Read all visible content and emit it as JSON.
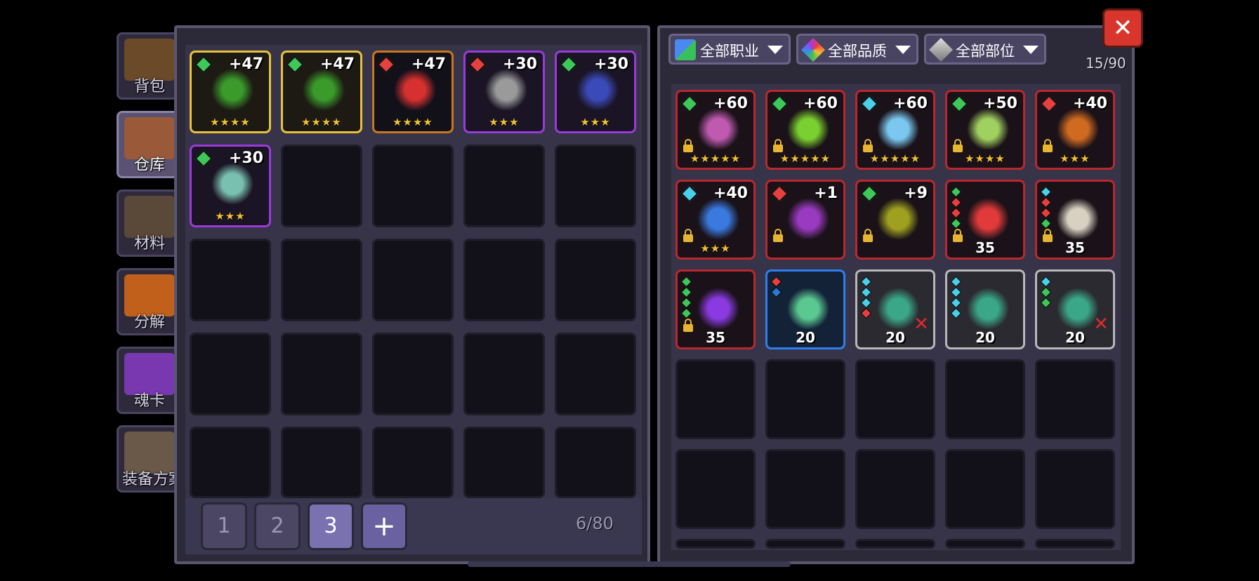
{
  "tabs": [
    {
      "label": "背包",
      "active": false,
      "color": "#6b4a2a"
    },
    {
      "label": "仓库",
      "active": true,
      "color": "#9a5a3a"
    },
    {
      "label": "材料",
      "active": false,
      "color": "#5a4838"
    },
    {
      "label": "分解",
      "active": false,
      "color": "#c0601a"
    },
    {
      "label": "魂卡",
      "active": false,
      "color": "#7a38b0"
    },
    {
      "label": "装备方案",
      "active": false,
      "color": "#6a5848"
    }
  ],
  "storage": {
    "count": "6/80",
    "pages": [
      "1",
      "2",
      "3"
    ],
    "active_page": "3",
    "add_label": "+",
    "items": [
      {
        "level": "+47",
        "stars": "★★★★",
        "rarity": "gold",
        "gem": "#3ec85a",
        "icon": "green-gun-icon",
        "art": "#3a9a2a"
      },
      {
        "level": "+47",
        "stars": "★★★★",
        "rarity": "gold",
        "gem": "#3ec85a",
        "icon": "green-gun-icon",
        "art": "#3a9a2a"
      },
      {
        "level": "+47",
        "stars": "★★★★",
        "rarity": "orange",
        "gem": "#e84040",
        "icon": "red-hook-icon",
        "art": "#d63030"
      },
      {
        "level": "+30",
        "stars": "★★★",
        "rarity": "purple",
        "gem": "#e84040",
        "icon": "grey-horn-icon",
        "art": "#9a9a9a"
      },
      {
        "level": "+30",
        "stars": "★★★",
        "rarity": "purple",
        "gem": "#3ec85a",
        "icon": "blue-blaster-icon",
        "art": "#3a4ab8"
      },
      {
        "level": "+30",
        "stars": "★★★",
        "rarity": "purple",
        "gem": "#3ec85a",
        "icon": "orb-launcher-icon",
        "art": "#7ac0b0"
      }
    ]
  },
  "filters": [
    {
      "label": "全部职业",
      "icon": "class-grid-icon"
    },
    {
      "label": "全部品质",
      "icon": "rainbow-diamond-icon"
    },
    {
      "label": "全部部位",
      "icon": "grey-diamond-icon"
    }
  ],
  "backpack": {
    "count": "15/90",
    "items": [
      {
        "level": "+60",
        "stars": "★★★★★",
        "rarity": "red",
        "gem": "#3ec85a",
        "lock": true,
        "icon": "claw-weapon-icon",
        "art": "#c05ab0"
      },
      {
        "level": "+60",
        "stars": "★★★★★",
        "rarity": "red",
        "gem": "#3ec85a",
        "lock": true,
        "icon": "green-scythe-icon",
        "art": "#7ad030"
      },
      {
        "level": "+60",
        "stars": "★★★★★",
        "rarity": "red",
        "gem": "#4ad0e8",
        "lock": true,
        "icon": "ice-shuriken-icon",
        "art": "#7ac8f0"
      },
      {
        "level": "+50",
        "stars": "★★★★",
        "rarity": "red",
        "gem": "#3ec85a",
        "lock": true,
        "icon": "leek-blade-icon",
        "art": "#a0d060"
      },
      {
        "level": "+40",
        "stars": "★★★",
        "rarity": "red",
        "gem": "#e84040",
        "lock": true,
        "icon": "fire-ring-icon",
        "art": "#d06a20"
      },
      {
        "level": "+40",
        "stars": "★★★",
        "rarity": "red",
        "gem": "#4ad0e8",
        "lock": true,
        "icon": "ice-staff-icon",
        "art": "#3a7ae0"
      },
      {
        "level": "+1",
        "stars": "",
        "rarity": "red",
        "gem": "#e84040",
        "lock": true,
        "icon": "purple-orb-icon",
        "art": "#9a3ac0"
      },
      {
        "level": "+9",
        "stars": "",
        "rarity": "red",
        "gem": "#3ec85a",
        "lock": true,
        "icon": "gold-amulet-icon",
        "art": "#a0a020"
      },
      {
        "number": "35",
        "rarity": "red",
        "lock": true,
        "icon": "red-helmet-icon",
        "art": "#e03a3a",
        "gems": [
          "#3ec85a",
          "#e84040",
          "#e84040",
          "#3ec85a"
        ]
      },
      {
        "number": "35",
        "rarity": "red",
        "lock": true,
        "icon": "bone-necklace-icon",
        "art": "#d8d0c0",
        "gems": [
          "#4ad0e8",
          "#e84040",
          "#e84040",
          "#3ec85a"
        ]
      },
      {
        "number": "35",
        "rarity": "red",
        "lock": true,
        "icon": "purple-boots-icon",
        "art": "#8a3ae0",
        "gems": [
          "#3ec85a",
          "#3ec85a",
          "#3ec85a",
          "#3ec85a"
        ]
      },
      {
        "number": "20",
        "rarity": "blue",
        "lock": false,
        "icon": "green-glove-icon",
        "art": "#5ac890",
        "gems": [
          "#e84040",
          "#2a7ad0"
        ]
      },
      {
        "number": "20",
        "rarity": "silver",
        "lock": false,
        "icon": "scarab-armor-icon",
        "art": "#3aa888",
        "gems": [
          "#4ad0e8",
          "#4ad0e8",
          "#4ad0e8",
          "#e84040"
        ],
        "broken": true
      },
      {
        "number": "20",
        "rarity": "silver",
        "lock": false,
        "icon": "scarab-ring-icon",
        "art": "#3aa888",
        "gems": [
          "#4ad0e8",
          "#4ad0e8",
          "#4ad0e8",
          "#4ad0e8"
        ]
      },
      {
        "number": "20",
        "rarity": "silver",
        "lock": false,
        "icon": "scarab-armor-icon",
        "art": "#3aa888",
        "gems": [
          "#4ad0e8",
          "#3ec85a",
          "#3ec85a"
        ],
        "broken": true
      }
    ]
  },
  "close_label": "✕"
}
